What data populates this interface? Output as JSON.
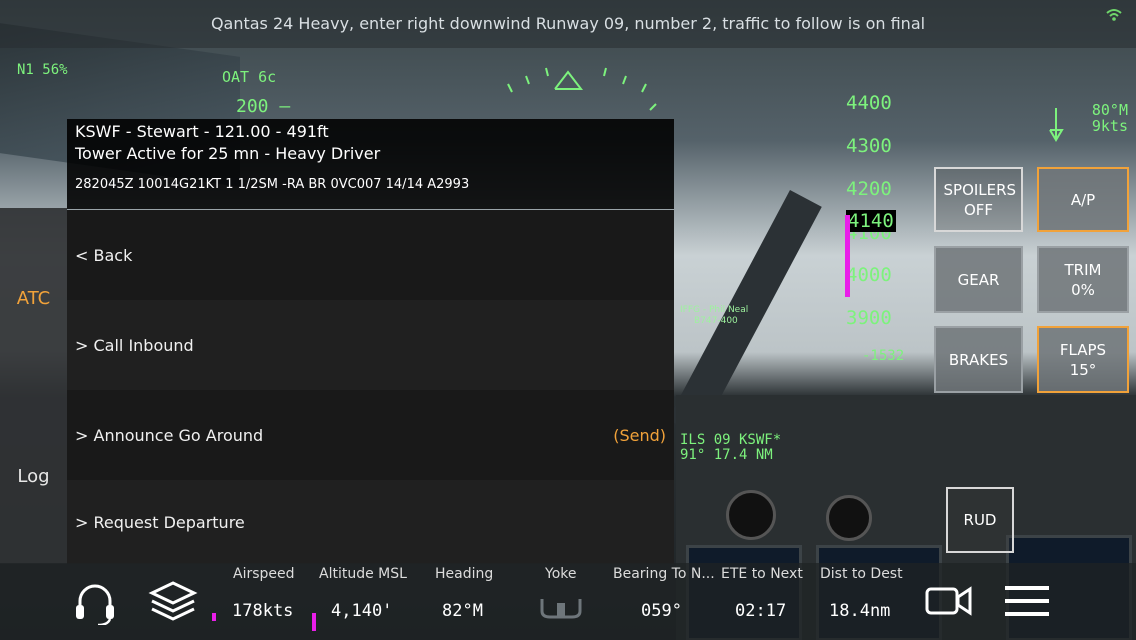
{
  "atc_message": "Qantas 24 Heavy, enter right downwind Runway 09, number 2, traffic to follow is on final",
  "hud": {
    "n1": "N1  56%",
    "oat": "OAT 6c",
    "speed_tape": "200",
    "altitude_ticks": [
      "4400",
      "4300",
      "4200",
      "4100",
      "4000",
      "3900"
    ],
    "altitude_current": "4140",
    "vertical_speed": "-1532",
    "wind_dir": "80°M",
    "wind_speed": "9kts",
    "ils_line1": "ILS 09 KSWF*",
    "ils_line2": "91° 17.4 NM",
    "traffic_line1": "IFFG - Phil Neal",
    "traffic_line2": "B747-400"
  },
  "controls": {
    "spoilers": "SPOILERS OFF",
    "autopilot": "A/P",
    "gear": "GEAR",
    "trim_label": "TRIM",
    "trim_value": "0%",
    "brakes": "BRAKES",
    "flaps_label": "FLAPS",
    "flaps_value": "15°",
    "rudder": "RUD"
  },
  "sidebar": {
    "atc": "ATC",
    "log": "Log"
  },
  "station": {
    "line1": "KSWF - Stewart - 121.00 - 491ft",
    "line2": "Tower Active for 25 mn - Heavy Driver",
    "metar": "282045Z 10014G21KT 1 1/2SM -RA BR 0VC007 14/14 A2993"
  },
  "menu": {
    "back": "< Back",
    "call_inbound": "> Call Inbound",
    "go_around": "> Announce Go Around",
    "send": "(Send)",
    "request_departure": "> Request Departure"
  },
  "stats": [
    {
      "label": "Airspeed",
      "value": "178kts"
    },
    {
      "label": "Altitude MSL",
      "value": "4,140'"
    },
    {
      "label": "Heading",
      "value": "82°M"
    },
    {
      "label": "Yoke",
      "value": ""
    },
    {
      "label": "Bearing To N...",
      "value": "059°"
    },
    {
      "label": "ETE to Next",
      "value": "02:17"
    },
    {
      "label": "Dist to Dest",
      "value": "18.4nm"
    }
  ],
  "colors": {
    "hud_green": "#7df27d",
    "accent_orange": "#f1a23a",
    "magenta": "#e91ee9"
  },
  "icons": [
    "wifi-icon",
    "headset-icon",
    "layers-icon",
    "camera-icon",
    "menu-icon",
    "yoke-icon"
  ]
}
